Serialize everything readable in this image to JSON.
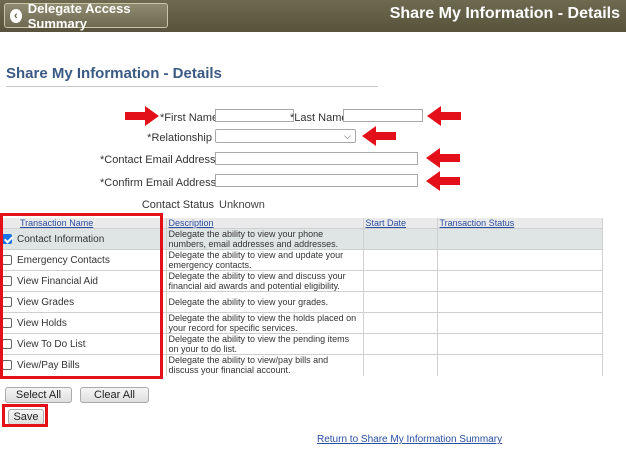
{
  "header": {
    "back_label": "Delegate Access Summary",
    "title": "Share My Information - Details"
  },
  "page": {
    "title": "Share My Information - Details"
  },
  "form": {
    "first_name_label": "*First Name",
    "last_name_label": "*Last Name",
    "relationship_label": "*Relationship",
    "contact_email_label": "*Contact Email Address",
    "confirm_email_label": "*Confirm Email Address",
    "contact_status_label": "Contact Status",
    "contact_status_value": "Unknown"
  },
  "table": {
    "columns": [
      "Transaction Name",
      "Description",
      "Start Date",
      "Transaction Status"
    ],
    "rows": [
      {
        "name": "Contact Information",
        "description": "Delegate the ability to view your phone numbers, email addresses and addresses.",
        "checked": true
      },
      {
        "name": "Emergency Contacts",
        "description": "Delegate the ability to view and update your emergency contacts.",
        "checked": false
      },
      {
        "name": "View Financial Aid",
        "description": "Delegate the ability to view and discuss your financial aid awards and potential eligibility.",
        "checked": false
      },
      {
        "name": "View Grades",
        "description": "Delegate the ability to view your grades.",
        "checked": false
      },
      {
        "name": "View Holds",
        "description": "Delegate the ability to view the holds placed on your record for specific services.",
        "checked": false
      },
      {
        "name": "View To Do List",
        "description": "Delegate the ability to view the pending items on your to do list.",
        "checked": false
      },
      {
        "name": "View/Pay Bills",
        "description": "Delegate the ability to view/pay bills and discuss your financial account.",
        "checked": false
      }
    ]
  },
  "actions": {
    "select_all": "Select All",
    "clear_all": "Clear All",
    "save": "Save",
    "return_link": "Return to Share My Information Summary"
  },
  "colors": {
    "header_bg": "#5e5a43",
    "title_blue": "#3a5a84",
    "highlight_red": "#e3101a",
    "checkbox_blue": "#1a73e8"
  }
}
